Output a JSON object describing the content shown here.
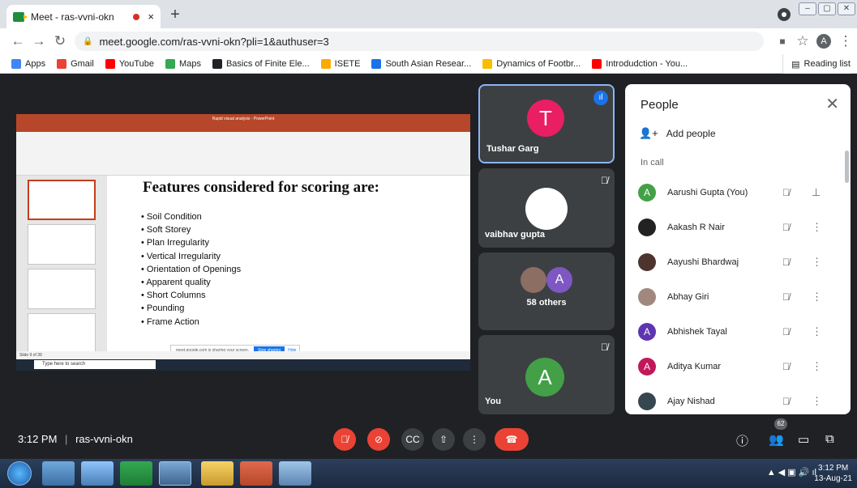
{
  "browser": {
    "tab_title": "Meet - ras-vvni-okn",
    "tab_close": "×",
    "new_tab": "+",
    "url": "meet.google.com/ras-vvni-okn?pli=1&authuser=3",
    "profile_initial": "A",
    "window_controls": [
      "–",
      "▢",
      "✕"
    ],
    "bookmarks": [
      {
        "label": "Apps",
        "color": "#4285f4"
      },
      {
        "label": "Gmail",
        "color": "#ea4335"
      },
      {
        "label": "YouTube",
        "color": "#ff0000"
      },
      {
        "label": "Maps",
        "color": "#34a853"
      },
      {
        "label": "Basics of Finite Ele...",
        "color": "#202124"
      },
      {
        "label": "ISETE",
        "color": "#f9ab00"
      },
      {
        "label": "South Asian Resear...",
        "color": "#1a73e8"
      },
      {
        "label": "Dynamics of Footbr...",
        "color": "#fbbc04"
      },
      {
        "label": "Introdudction - You...",
        "color": "#ff0000"
      }
    ],
    "reading_list": "Reading list"
  },
  "presentation": {
    "window_title": "Rapid visual analysis - PowerPoint",
    "slide_title": "Features considered for scoring are:",
    "bullets": [
      "Soil Condition",
      "Soft Storey",
      "Plan Irregularity",
      "Vertical Irregularity",
      "Orientation of Openings",
      "Apparent quality",
      "Short Columns",
      "Pounding",
      "Frame Action"
    ],
    "share_banner": "meet.google.com is sharing your screen.",
    "stop_sharing": "Stop sharing",
    "hide": "Hide",
    "status": "Slide 9 of 39",
    "search_placeholder": "Type here to search"
  },
  "tiles": [
    {
      "name": "Tushar Garg",
      "initial": "T",
      "color": "#e91e63"
    },
    {
      "name": "vaibhav gupta",
      "initial": "",
      "color": "#ffffff"
    },
    {
      "name": "58 others",
      "initial": "A",
      "color": "#7e57c2"
    },
    {
      "name": "You",
      "initial": "A",
      "color": "#43a047"
    }
  ],
  "people_panel": {
    "title": "People",
    "add_people": "Add people",
    "in_call": "In call",
    "participants": [
      {
        "name": "Aarushi Gupta (You)",
        "initial": "A",
        "color": "#43a047"
      },
      {
        "name": "Aakash R Nair",
        "initial": "",
        "color": "#222222"
      },
      {
        "name": "Aayushi Bhardwaj",
        "initial": "",
        "color": "#4e342e"
      },
      {
        "name": "Abhay Giri",
        "initial": "",
        "color": "#a1887f"
      },
      {
        "name": "Abhishek Tayal",
        "initial": "A",
        "color": "#5e35b1"
      },
      {
        "name": "Aditya Kumar",
        "initial": "A",
        "color": "#c2185b"
      },
      {
        "name": "Ajay Nishad",
        "initial": "",
        "color": "#37474f"
      }
    ]
  },
  "meeting": {
    "time": "3:12 PM",
    "separator": "|",
    "code": "ras-vvni-okn",
    "people_count": "62"
  },
  "taskbar": {
    "time": "3:12 PM",
    "date": "13-Aug-21"
  }
}
